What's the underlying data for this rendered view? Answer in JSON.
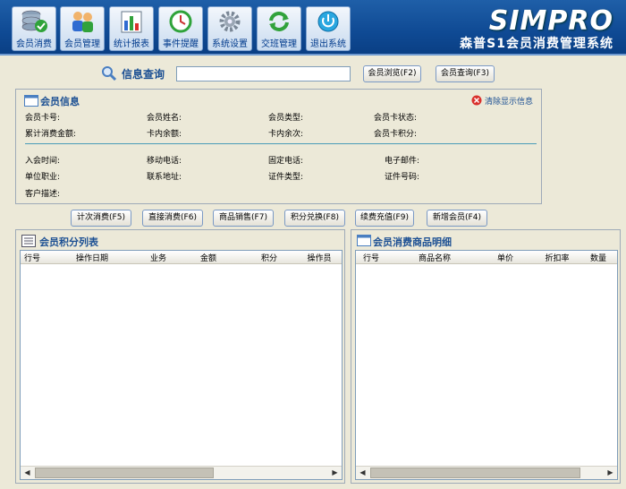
{
  "toolbar": {
    "items": [
      {
        "label": "会员消费",
        "icon": "database-check-icon"
      },
      {
        "label": "会员管理",
        "icon": "users-icon"
      },
      {
        "label": "统计报表",
        "icon": "chart-icon"
      },
      {
        "label": "事件提醒",
        "icon": "clock-icon"
      },
      {
        "label": "系统设置",
        "icon": "gear-icon"
      },
      {
        "label": "交班管理",
        "icon": "refresh-icon"
      },
      {
        "label": "退出系统",
        "icon": "power-icon"
      }
    ]
  },
  "brand": {
    "logo": "SIMPRO",
    "subtitle": "森普S1会员消费管理系统"
  },
  "search": {
    "label": "信息查询",
    "value": "",
    "browse_button": "会员浏览(F2)",
    "query_button": "会员查询(F3)"
  },
  "member_info": {
    "title": "会员信息",
    "clear_button": "清除显示信息",
    "row1": [
      "会员卡号:",
      "会员姓名:",
      "会员类型:",
      "会员卡状态:"
    ],
    "row2": [
      "累计消费金额:",
      "卡内余额:",
      "卡内余次:",
      "会员卡积分:"
    ],
    "row3": [
      "入会时间:",
      "移动电话:",
      "固定电话:",
      "电子邮件:"
    ],
    "row4": [
      "单位职业:",
      "联系地址:",
      "证件类型:",
      "证件号码:"
    ],
    "row5": [
      "客户描述:"
    ]
  },
  "actions": [
    "计次消费(F5)",
    "直接消费(F6)",
    "商品销售(F7)",
    "积分兑换(F8)",
    "续费充值(F9)",
    "新增会员(F4)"
  ],
  "points_list": {
    "title": "会员积分列表",
    "columns": [
      "行号",
      "操作日期",
      "业务",
      "金额",
      "积分",
      "操作员"
    ]
  },
  "goods_detail": {
    "title": "会员消费商品明细",
    "columns": [
      "行号",
      "商品名称",
      "单价",
      "折扣率",
      "数量"
    ]
  },
  "colors": {
    "topbar": "#1558a6",
    "accent": "#1b4f93",
    "clear_icon": "#d9302c"
  }
}
